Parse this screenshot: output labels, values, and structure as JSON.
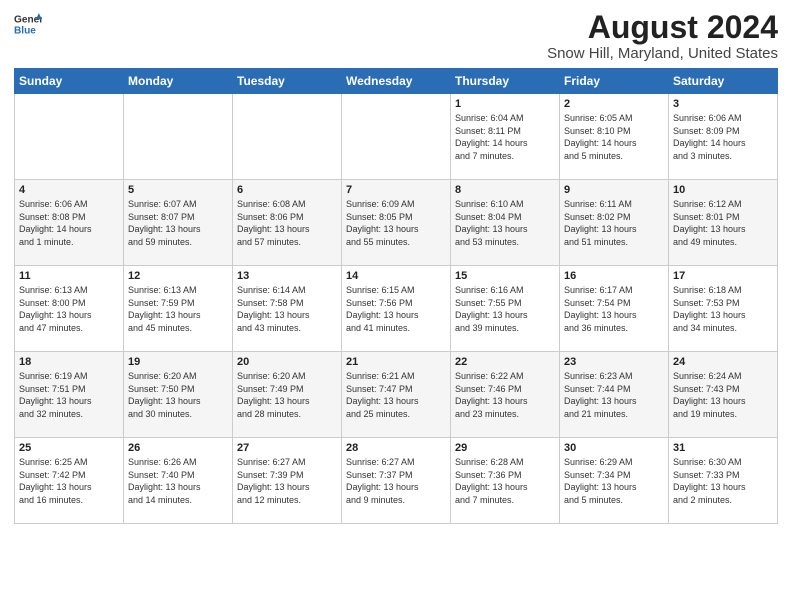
{
  "logo": {
    "general": "General",
    "blue": "Blue"
  },
  "title": "August 2024",
  "subtitle": "Snow Hill, Maryland, United States",
  "headers": [
    "Sunday",
    "Monday",
    "Tuesday",
    "Wednesday",
    "Thursday",
    "Friday",
    "Saturday"
  ],
  "weeks": [
    [
      {
        "day": "",
        "info": ""
      },
      {
        "day": "",
        "info": ""
      },
      {
        "day": "",
        "info": ""
      },
      {
        "day": "",
        "info": ""
      },
      {
        "day": "1",
        "info": "Sunrise: 6:04 AM\nSunset: 8:11 PM\nDaylight: 14 hours\nand 7 minutes."
      },
      {
        "day": "2",
        "info": "Sunrise: 6:05 AM\nSunset: 8:10 PM\nDaylight: 14 hours\nand 5 minutes."
      },
      {
        "day": "3",
        "info": "Sunrise: 6:06 AM\nSunset: 8:09 PM\nDaylight: 14 hours\nand 3 minutes."
      }
    ],
    [
      {
        "day": "4",
        "info": "Sunrise: 6:06 AM\nSunset: 8:08 PM\nDaylight: 14 hours\nand 1 minute."
      },
      {
        "day": "5",
        "info": "Sunrise: 6:07 AM\nSunset: 8:07 PM\nDaylight: 13 hours\nand 59 minutes."
      },
      {
        "day": "6",
        "info": "Sunrise: 6:08 AM\nSunset: 8:06 PM\nDaylight: 13 hours\nand 57 minutes."
      },
      {
        "day": "7",
        "info": "Sunrise: 6:09 AM\nSunset: 8:05 PM\nDaylight: 13 hours\nand 55 minutes."
      },
      {
        "day": "8",
        "info": "Sunrise: 6:10 AM\nSunset: 8:04 PM\nDaylight: 13 hours\nand 53 minutes."
      },
      {
        "day": "9",
        "info": "Sunrise: 6:11 AM\nSunset: 8:02 PM\nDaylight: 13 hours\nand 51 minutes."
      },
      {
        "day": "10",
        "info": "Sunrise: 6:12 AM\nSunset: 8:01 PM\nDaylight: 13 hours\nand 49 minutes."
      }
    ],
    [
      {
        "day": "11",
        "info": "Sunrise: 6:13 AM\nSunset: 8:00 PM\nDaylight: 13 hours\nand 47 minutes."
      },
      {
        "day": "12",
        "info": "Sunrise: 6:13 AM\nSunset: 7:59 PM\nDaylight: 13 hours\nand 45 minutes."
      },
      {
        "day": "13",
        "info": "Sunrise: 6:14 AM\nSunset: 7:58 PM\nDaylight: 13 hours\nand 43 minutes."
      },
      {
        "day": "14",
        "info": "Sunrise: 6:15 AM\nSunset: 7:56 PM\nDaylight: 13 hours\nand 41 minutes."
      },
      {
        "day": "15",
        "info": "Sunrise: 6:16 AM\nSunset: 7:55 PM\nDaylight: 13 hours\nand 39 minutes."
      },
      {
        "day": "16",
        "info": "Sunrise: 6:17 AM\nSunset: 7:54 PM\nDaylight: 13 hours\nand 36 minutes."
      },
      {
        "day": "17",
        "info": "Sunrise: 6:18 AM\nSunset: 7:53 PM\nDaylight: 13 hours\nand 34 minutes."
      }
    ],
    [
      {
        "day": "18",
        "info": "Sunrise: 6:19 AM\nSunset: 7:51 PM\nDaylight: 13 hours\nand 32 minutes."
      },
      {
        "day": "19",
        "info": "Sunrise: 6:20 AM\nSunset: 7:50 PM\nDaylight: 13 hours\nand 30 minutes."
      },
      {
        "day": "20",
        "info": "Sunrise: 6:20 AM\nSunset: 7:49 PM\nDaylight: 13 hours\nand 28 minutes."
      },
      {
        "day": "21",
        "info": "Sunrise: 6:21 AM\nSunset: 7:47 PM\nDaylight: 13 hours\nand 25 minutes."
      },
      {
        "day": "22",
        "info": "Sunrise: 6:22 AM\nSunset: 7:46 PM\nDaylight: 13 hours\nand 23 minutes."
      },
      {
        "day": "23",
        "info": "Sunrise: 6:23 AM\nSunset: 7:44 PM\nDaylight: 13 hours\nand 21 minutes."
      },
      {
        "day": "24",
        "info": "Sunrise: 6:24 AM\nSunset: 7:43 PM\nDaylight: 13 hours\nand 19 minutes."
      }
    ],
    [
      {
        "day": "25",
        "info": "Sunrise: 6:25 AM\nSunset: 7:42 PM\nDaylight: 13 hours\nand 16 minutes."
      },
      {
        "day": "26",
        "info": "Sunrise: 6:26 AM\nSunset: 7:40 PM\nDaylight: 13 hours\nand 14 minutes."
      },
      {
        "day": "27",
        "info": "Sunrise: 6:27 AM\nSunset: 7:39 PM\nDaylight: 13 hours\nand 12 minutes."
      },
      {
        "day": "28",
        "info": "Sunrise: 6:27 AM\nSunset: 7:37 PM\nDaylight: 13 hours\nand 9 minutes."
      },
      {
        "day": "29",
        "info": "Sunrise: 6:28 AM\nSunset: 7:36 PM\nDaylight: 13 hours\nand 7 minutes."
      },
      {
        "day": "30",
        "info": "Sunrise: 6:29 AM\nSunset: 7:34 PM\nDaylight: 13 hours\nand 5 minutes."
      },
      {
        "day": "31",
        "info": "Sunrise: 6:30 AM\nSunset: 7:33 PM\nDaylight: 13 hours\nand 2 minutes."
      }
    ]
  ]
}
